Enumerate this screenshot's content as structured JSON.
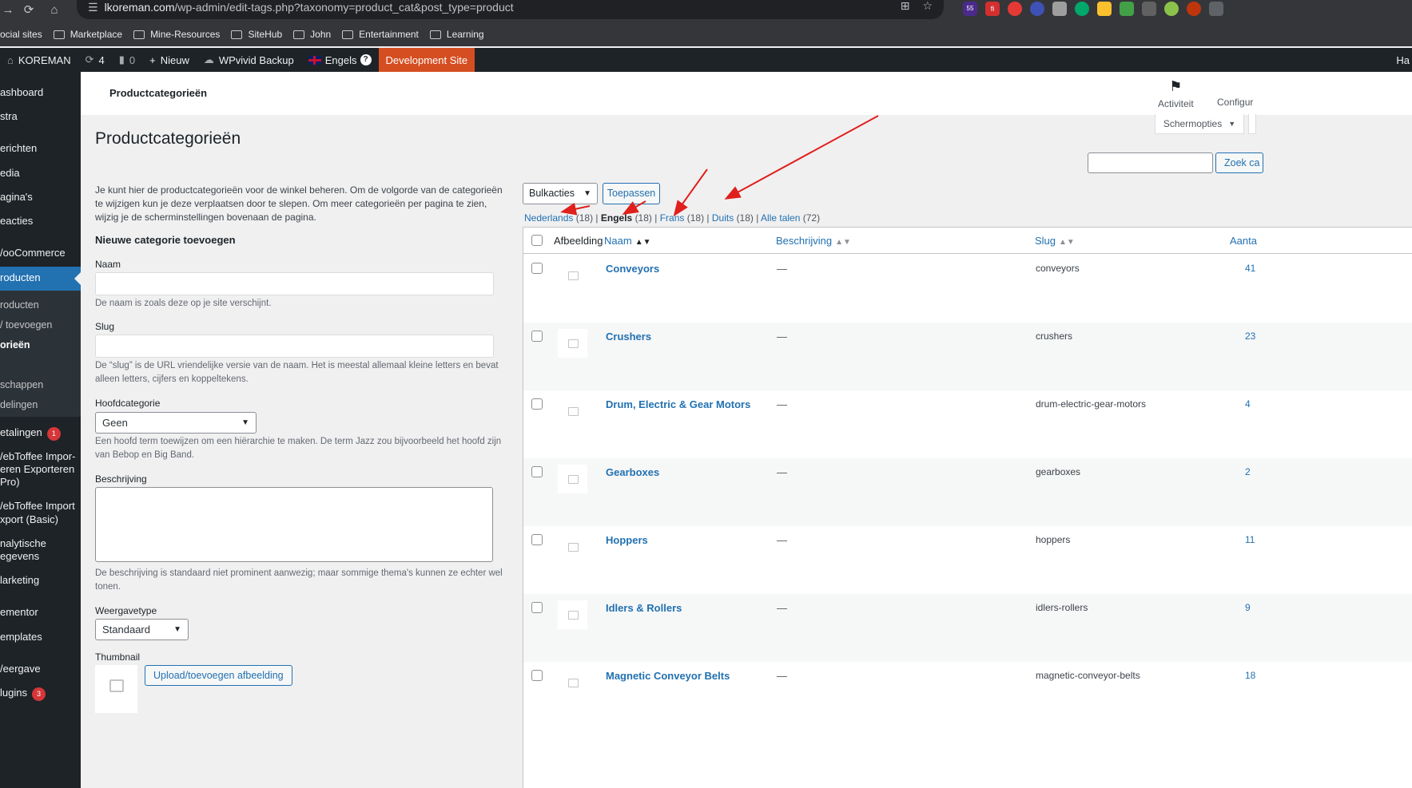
{
  "browser": {
    "url_domain": "lkoreman.com",
    "url_path": "/wp-admin/edit-tags.php?taxonomy=product_cat&post_type=product",
    "extension_badge": "55",
    "bookmarks": [
      "ocial sites",
      "Marketplace",
      "Mine-Resources",
      "SiteHub",
      "John",
      "Entertainment",
      "Learning"
    ]
  },
  "adminbar": {
    "site": "KOREMAN",
    "updates": "4",
    "comments": "0",
    "new": "Nieuw",
    "backup": "WPvivid Backup",
    "language": "Engels",
    "dev": "Development Site",
    "right": "Ha"
  },
  "sidebar": {
    "items": [
      "ashboard",
      "stra",
      "erichten",
      "edia",
      "agina's",
      "eacties",
      "/ooCommerce",
      "roducten",
      "roducten",
      "/ toevoegen",
      "orieën",
      "schappen",
      "delingen",
      "etalingen",
      "/ebToffee Impor-",
      "eren Exporteren",
      "Pro)",
      "/ebToffee Import",
      "xport (Basic)",
      "nalytische",
      "egevens",
      "larketing",
      "ementor",
      "emplates",
      "/eergave",
      "lugins"
    ],
    "badge_payments": "1",
    "badge_plugins": "3"
  },
  "header": {
    "title": "Productcategorieën",
    "activity": "Activiteit",
    "config": "Configur",
    "screen_options": "Schermopties"
  },
  "page": {
    "title": "Productcategorieën",
    "intro": "Je kunt hier de productcategorieën voor de winkel beheren. Om de volgorde van de categorieën te wijzigen kun je deze verplaatsen door te slepen. Om meer categorieën per pagina te zien, wijzig je de scherminstellingen bovenaan de pagina.",
    "search_button": "Zoek ca"
  },
  "form": {
    "heading": "Nieuwe categorie toevoegen",
    "name_label": "Naam",
    "name_help": "De naam is zoals deze op je site verschijnt.",
    "slug_label": "Slug",
    "slug_help": "De “slug” is de URL vriendelijke versie van de naam. Het is meestal allemaal kleine letters en bevat alleen letters, cijfers en koppeltekens.",
    "parent_label": "Hoofdcategorie",
    "parent_value": "Geen",
    "parent_help": "Een hoofd term toewijzen om een hiërarchie te maken. De term Jazz zou bijvoorbeeld het hoofd zijn van Bebop en Big Band.",
    "desc_label": "Beschrijving",
    "desc_help": "De beschrijving is standaard niet prominent aanwezig; maar sommige thema's kunnen ze echter wel tonen.",
    "display_label": "Weergavetype",
    "display_value": "Standaard",
    "thumb_label": "Thumbnail",
    "upload_button": "Upload/toevoegen afbeelding"
  },
  "list": {
    "bulk": "Bulkacties",
    "apply": "Toepassen",
    "languages": [
      {
        "name": "Nederlands",
        "count": "(18)"
      },
      {
        "name": "Engels",
        "count": "(18)"
      },
      {
        "name": "Frans",
        "count": "(18)"
      },
      {
        "name": "Duits",
        "count": "(18)"
      },
      {
        "name": "Alle talen",
        "count": "(72)"
      }
    ],
    "columns": {
      "image": "Afbeelding",
      "name": "Naam",
      "desc": "Beschrijving",
      "slug": "Slug",
      "count": "Aanta"
    },
    "rows": [
      {
        "name": "Conveyors",
        "desc": "—",
        "slug": "conveyors",
        "count": "41"
      },
      {
        "name": "Crushers",
        "desc": "—",
        "slug": "crushers",
        "count": "23"
      },
      {
        "name": "Drum, Electric & Gear Motors",
        "desc": "—",
        "slug": "drum-electric-gear-motors",
        "count": "4"
      },
      {
        "name": "Gearboxes",
        "desc": "—",
        "slug": "gearboxes",
        "count": "2"
      },
      {
        "name": "Hoppers",
        "desc": "—",
        "slug": "hoppers",
        "count": "11"
      },
      {
        "name": "Idlers & Rollers",
        "desc": "—",
        "slug": "idlers-rollers",
        "count": "9"
      },
      {
        "name": "Magnetic Conveyor Belts",
        "desc": "—",
        "slug": "magnetic-conveyor-belts",
        "count": "18"
      }
    ]
  },
  "colors": {
    "accent": "#2271b1",
    "admin_bar": "#1d2327",
    "dev_badge": "#d54e21",
    "arrow": "#e0201c"
  }
}
